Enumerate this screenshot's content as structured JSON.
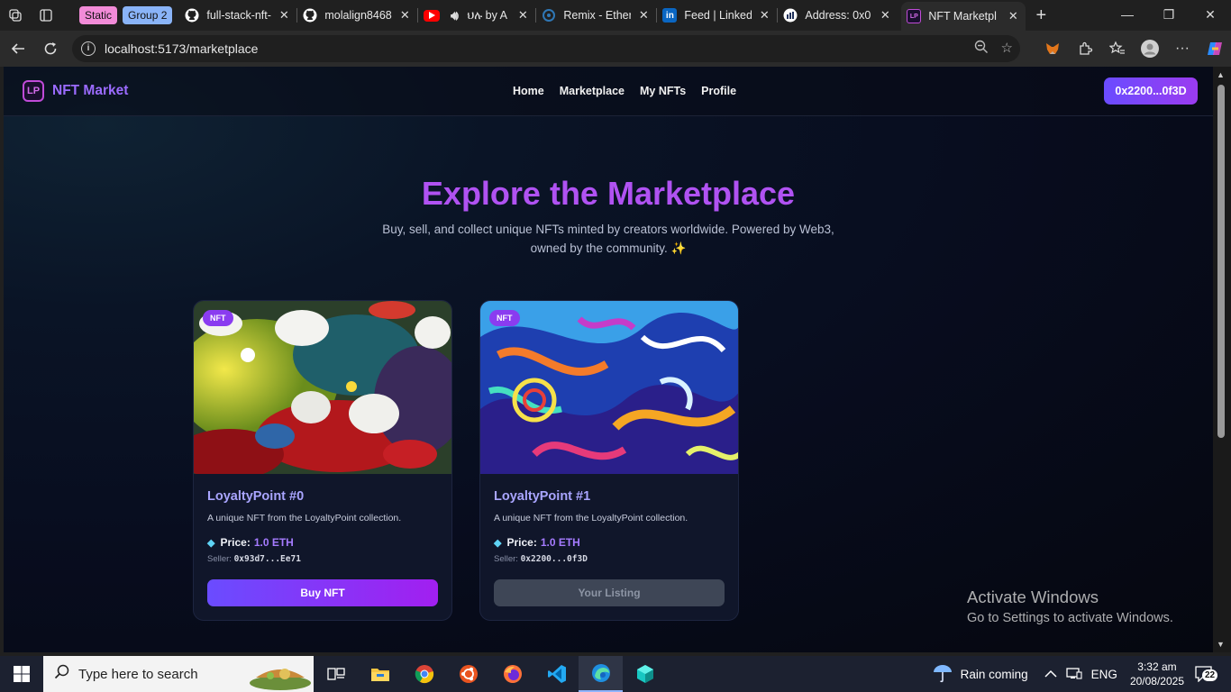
{
  "browser": {
    "tab_groups": [
      {
        "label": "Static",
        "color": "#f28bd8"
      },
      {
        "label": "Group 2",
        "color": "#8ab4f8"
      }
    ],
    "tabs": [
      {
        "title": "full-stack-nft-",
        "icon": "github-icon"
      },
      {
        "title": "molalign8468",
        "icon": "github-icon"
      },
      {
        "title": "ህሉ by A",
        "icon": "youtube-icon"
      },
      {
        "title": "Remix - Ether",
        "icon": "remix-icon"
      },
      {
        "title": "Feed | Linked",
        "icon": "linkedin-icon"
      },
      {
        "title": "Address: 0x0",
        "icon": "etherscan-icon"
      },
      {
        "title": "NFT Marketpl",
        "icon": "lp-icon",
        "active": true
      }
    ],
    "url": "localhost:5173/marketplace"
  },
  "app": {
    "brand_logo": "LP",
    "brand_name": "NFT Market",
    "nav": [
      "Home",
      "Marketplace",
      "My NFTs",
      "Profile"
    ],
    "wallet": "0x2200...0f3D"
  },
  "hero": {
    "title": "Explore the Marketplace",
    "subtitle": "Buy, sell, and collect unique NFTs minted by creators worldwide. Powered by Web3, owned by the community. ✨"
  },
  "nfts": [
    {
      "badge": "NFT",
      "name": "LoyaltyPoint #0",
      "description": "A unique NFT from the LoyaltyPoint collection.",
      "price_label": "Price:",
      "price": "1.0 ETH",
      "seller_label": "Seller:",
      "seller": "0x93d7...Ee71",
      "action": "Buy NFT",
      "owned": false
    },
    {
      "badge": "NFT",
      "name": "LoyaltyPoint #1",
      "description": "A unique NFT from the LoyaltyPoint collection.",
      "price_label": "Price:",
      "price": "1.0 ETH",
      "seller_label": "Seller:",
      "seller": "0x2200...0f3D",
      "action": "Your Listing",
      "owned": true
    }
  ],
  "watermark": {
    "line1": "Activate Windows",
    "line2": "Go to Settings to activate Windows."
  },
  "taskbar": {
    "search_placeholder": "Type here to search",
    "weather": "Rain coming",
    "lang": "ENG",
    "time": "3:32 am",
    "date": "20/08/2025",
    "notifications": "22"
  }
}
